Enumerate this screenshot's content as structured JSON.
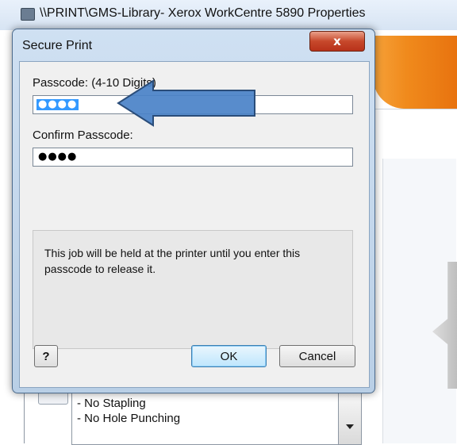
{
  "background_window": {
    "title": "\\\\PRINT\\GMS-Library- Xerox WorkCentre 5890 Properties",
    "options_list": [
      "- No Stapling",
      "- No Hole Punching"
    ]
  },
  "dialog": {
    "title": "Secure Print",
    "close_label": "x",
    "passcode_label": "Passcode: (4-10 Digits)",
    "passcode_value": "●●●●",
    "confirm_label": "Confirm Passcode:",
    "confirm_value": "●●●●",
    "info_text": "This job will be held at the printer until you enter this passcode to release it.",
    "help_label": "?",
    "ok_label": "OK",
    "cancel_label": "Cancel"
  },
  "colors": {
    "arrow_fill": "#4a82c8",
    "arrow_stroke": "#2a4d7a",
    "selection": "#3399ff",
    "banner_orange": "#f08a1c"
  },
  "icons": {
    "app_icon": "printer-icon",
    "arrow": "left-arrow-annotation"
  }
}
